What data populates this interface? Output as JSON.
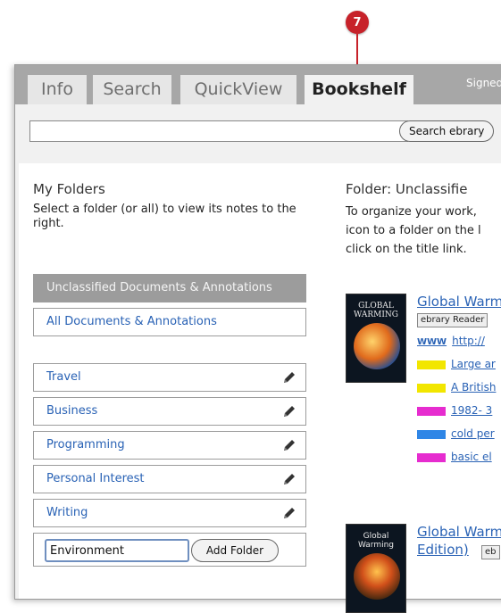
{
  "callout": {
    "number": "7"
  },
  "tabs": [
    {
      "label": "Info"
    },
    {
      "label": "Search"
    },
    {
      "label": "QuickView"
    },
    {
      "label": "Bookshelf"
    }
  ],
  "header": {
    "signed_text": "Signed"
  },
  "search": {
    "value": "",
    "placeholder": "",
    "button_label": "Search ebrary"
  },
  "left": {
    "heading": "My Folders",
    "description": "Select a folder (or all) to view its notes to the right.",
    "unclassified": "Unclassified Documents & Annotations",
    "all_docs": "All Documents & Annotations",
    "folders": [
      {
        "label": "Travel"
      },
      {
        "label": "Business"
      },
      {
        "label": "Programming"
      },
      {
        "label": "Personal Interest"
      },
      {
        "label": "Writing"
      }
    ],
    "new_folder": {
      "value": "Environment",
      "button_label": "Add Folder"
    }
  },
  "right": {
    "heading": "Folder: Unclassifie",
    "desc_lines": [
      "To organize your work,",
      "icon to a folder on the l",
      "click on the title link."
    ],
    "books": [
      {
        "title": "Global Warm",
        "cover_text": "GLOBAL WARMING",
        "reader_label": "ebrary Reader",
        "notes": [
          {
            "type": "www",
            "label": "WWW",
            "text": "http://"
          },
          {
            "type": "highlight",
            "color": "#f2e600",
            "text": "Large ar"
          },
          {
            "type": "highlight",
            "color": "#f2e600",
            "text": "A British"
          },
          {
            "type": "highlight",
            "color": "#e62ccf",
            "text": "1982- 3"
          },
          {
            "type": "highlight",
            "color": "#2f86e6",
            "text": "cold per"
          },
          {
            "type": "highlight",
            "color": "#e62ccf",
            "text": "basic el"
          }
        ]
      },
      {
        "title": "Global Warm",
        "title2": "Edition)",
        "reader_label": "eb",
        "cover_text": "Global Warming"
      }
    ]
  },
  "colors": {
    "link": "#2962b5",
    "tabbar": "#a7a7a7",
    "callout": "#c7222a"
  }
}
